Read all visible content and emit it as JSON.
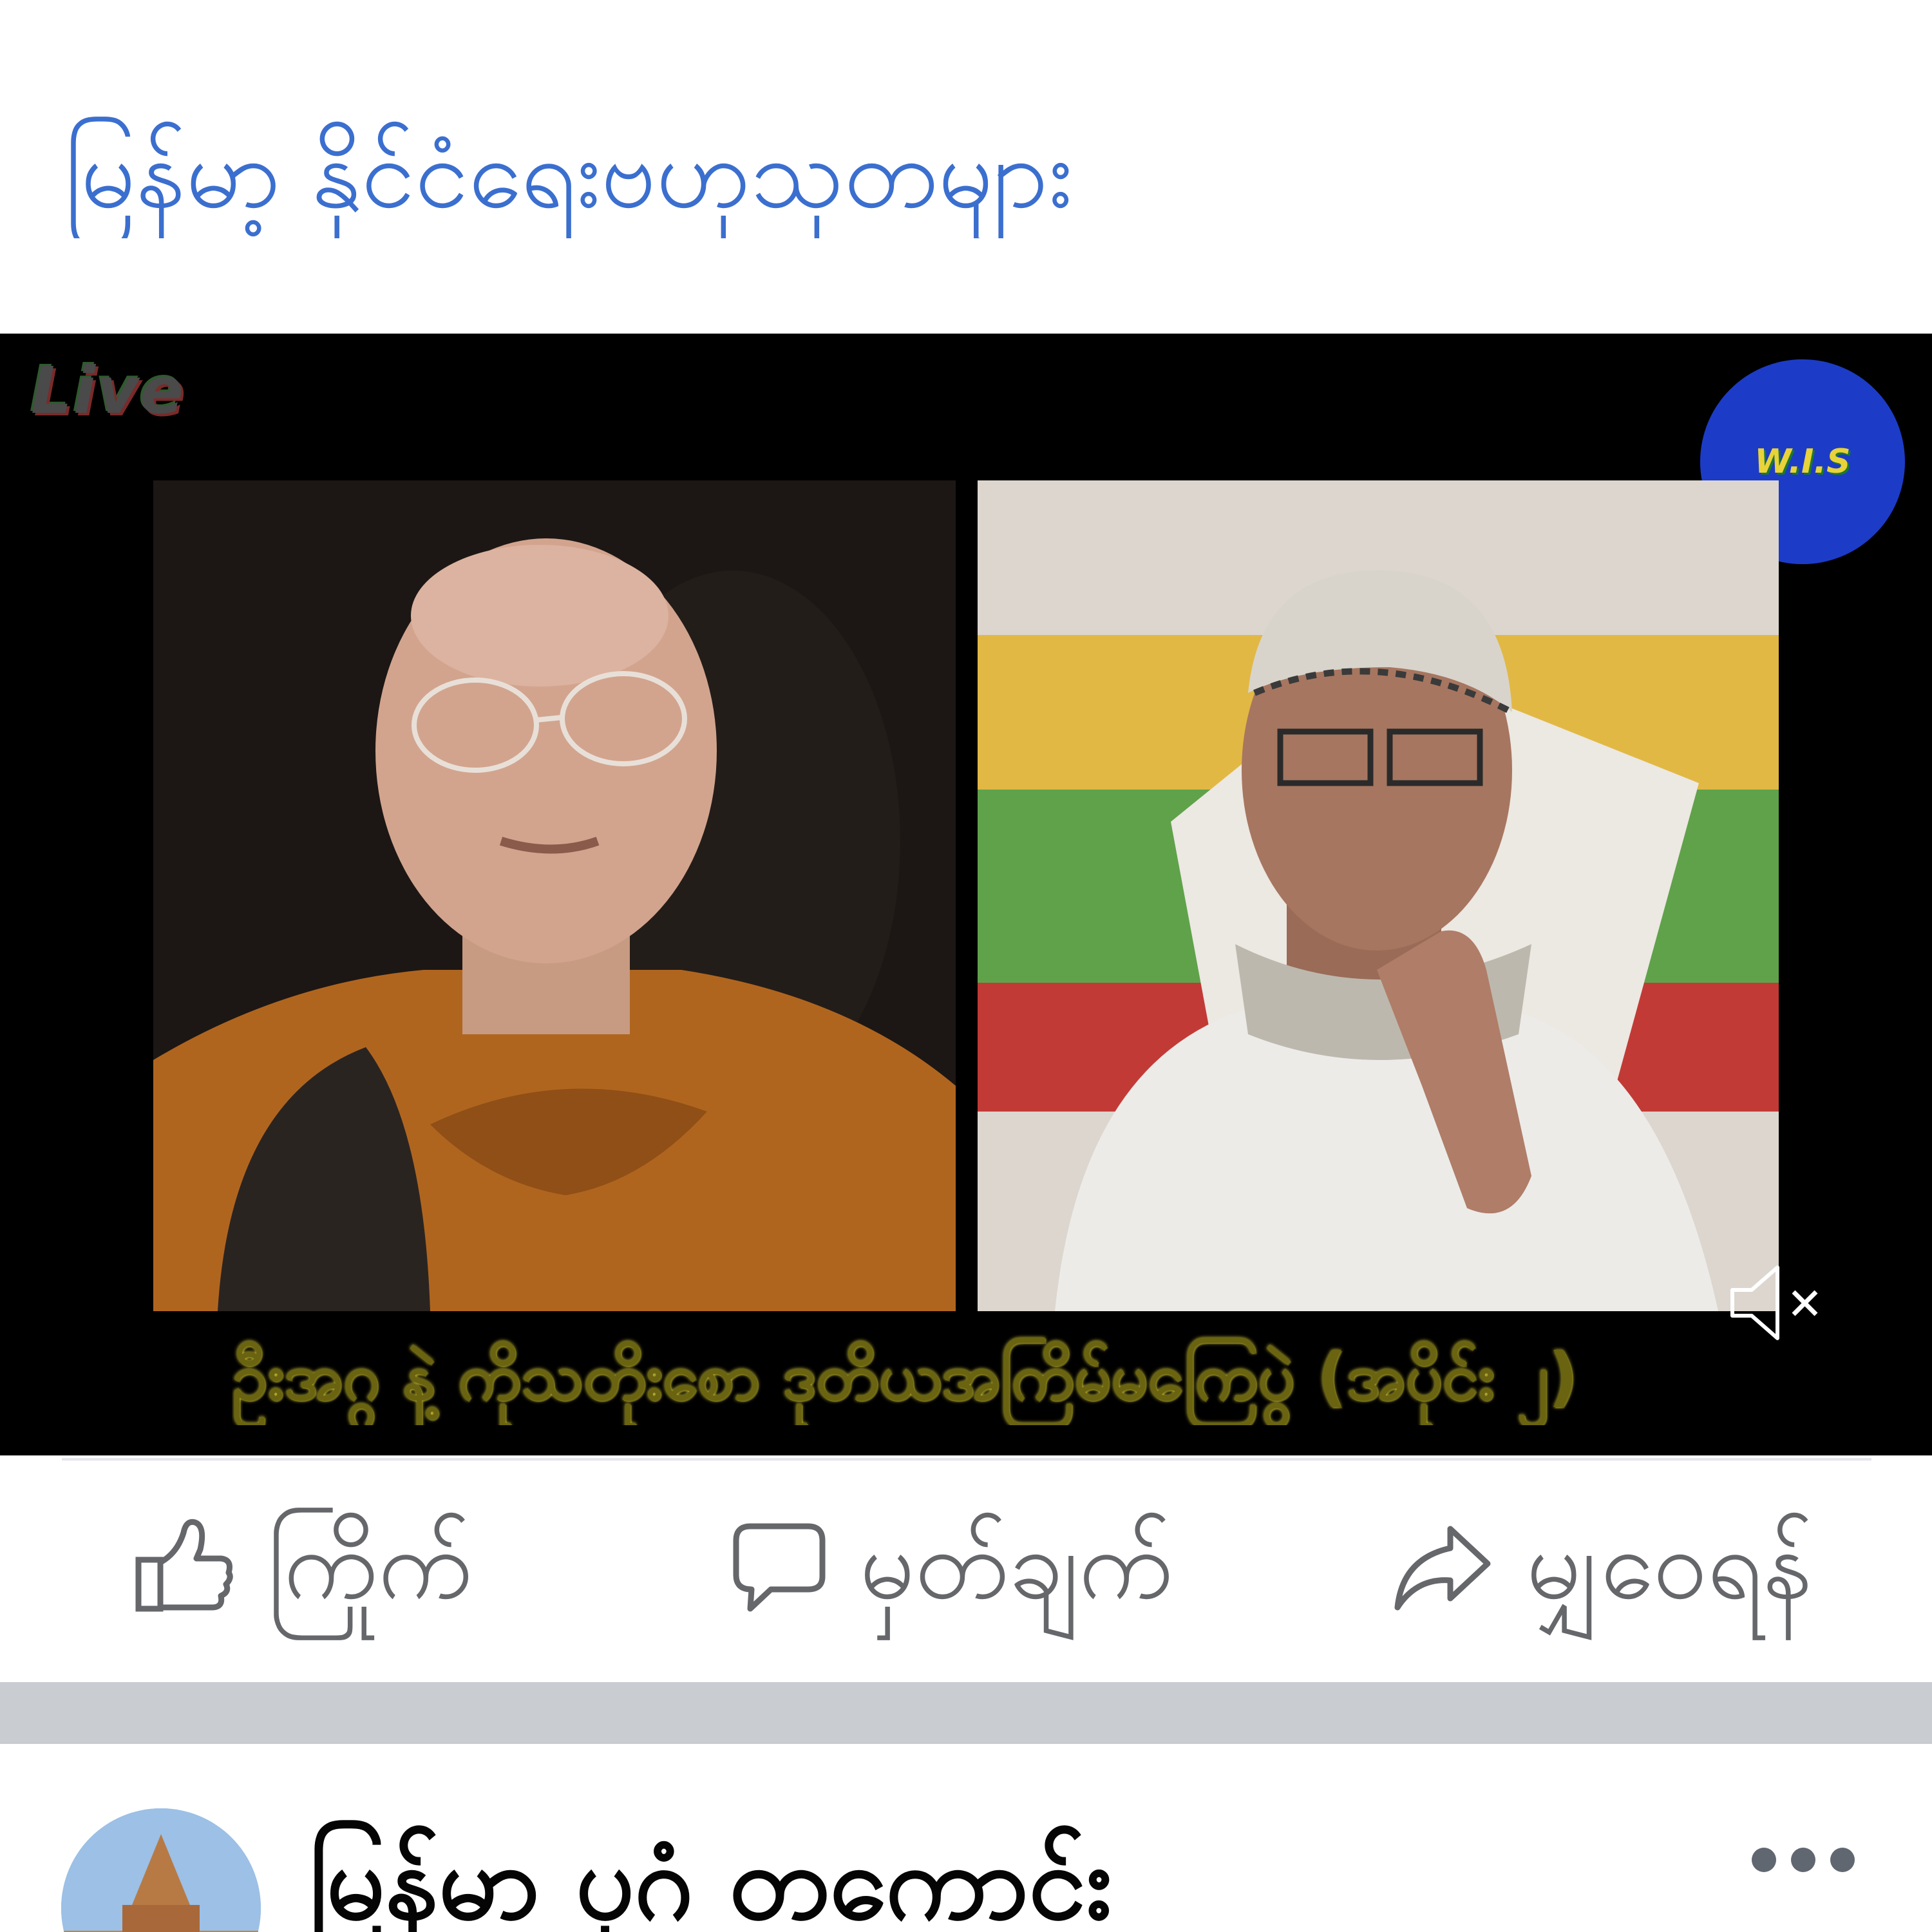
{
  "post": {
    "text": "မြန်မာ့ နိုင်ငံရေးဗဟုသုတများ"
  },
  "video": {
    "live_label": "Live",
    "channel_logo_text": "W.I.S",
    "caption": "ဦးအဂ္ဂ နဲ့ ကိုသတိုးစော ဒုတိယအကြိမ်မကြေပွဲ (အပိုင်း ၂)",
    "muted": true
  },
  "actions": {
    "like_label": "ကြိုက်",
    "comment_label": "မှတ်ချက်",
    "share_label": "မျှဝေရန်"
  },
  "next_post": {
    "page_name": "မြန်မာ ပုဂံ တကောင်း"
  },
  "colors": {
    "post_text": "#3b6fcf",
    "action_text": "#65676b",
    "separator": "#c9ccd1",
    "logo_blue": "#1c3cc7"
  }
}
